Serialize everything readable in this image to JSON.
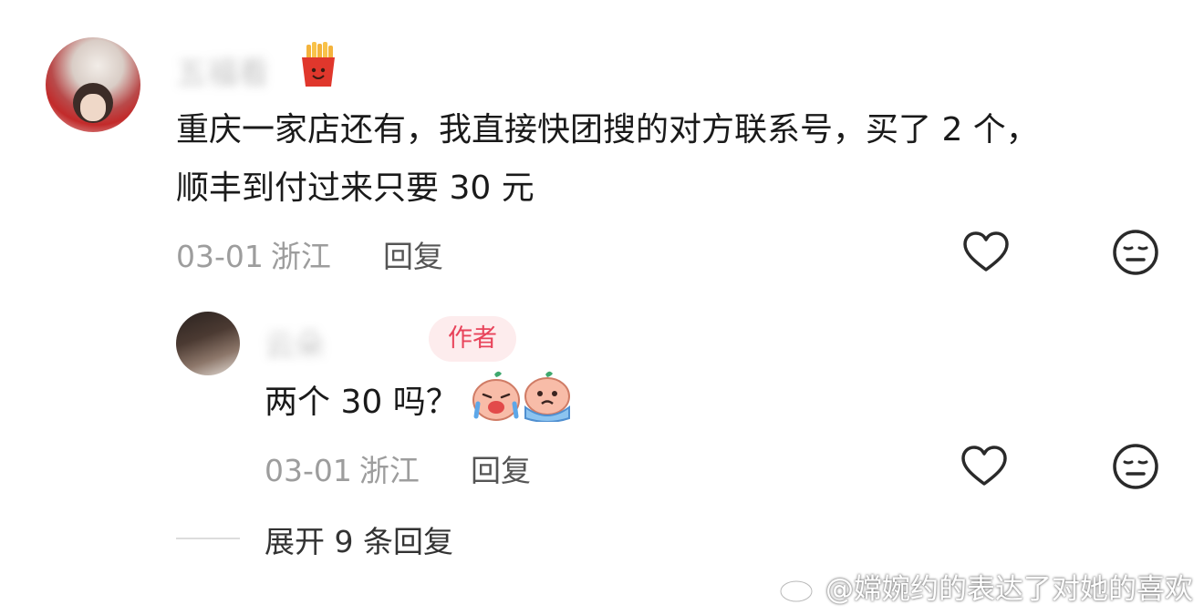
{
  "comment": {
    "username": "五福看",
    "text_line_1": "重庆一家店还有，我直接快团搜的对方联系号，买了 2 个，",
    "text_line_2": "顺丰到付过来只要 30 元",
    "date": "03-01",
    "location": "浙江",
    "reply_label": "回复",
    "badge_icon": "french-fries-icon"
  },
  "reply": {
    "username": "云朵",
    "author_tag": "作者",
    "text": "两个 30 吗？",
    "date": "03-01",
    "location": "浙江",
    "reply_label": "回复",
    "emojis": [
      "crying-emoji",
      "sad-emoji"
    ]
  },
  "thread": {
    "expand_label": "展开 9 条回复"
  },
  "watermark": {
    "text": "@嫦婉约的表达了对她的喜欢",
    "icon": "weibo-icon"
  },
  "colors": {
    "author_tag_bg": "#fdeced",
    "author_tag_text": "#e8435a",
    "meta_text": "#9d9d9d"
  }
}
